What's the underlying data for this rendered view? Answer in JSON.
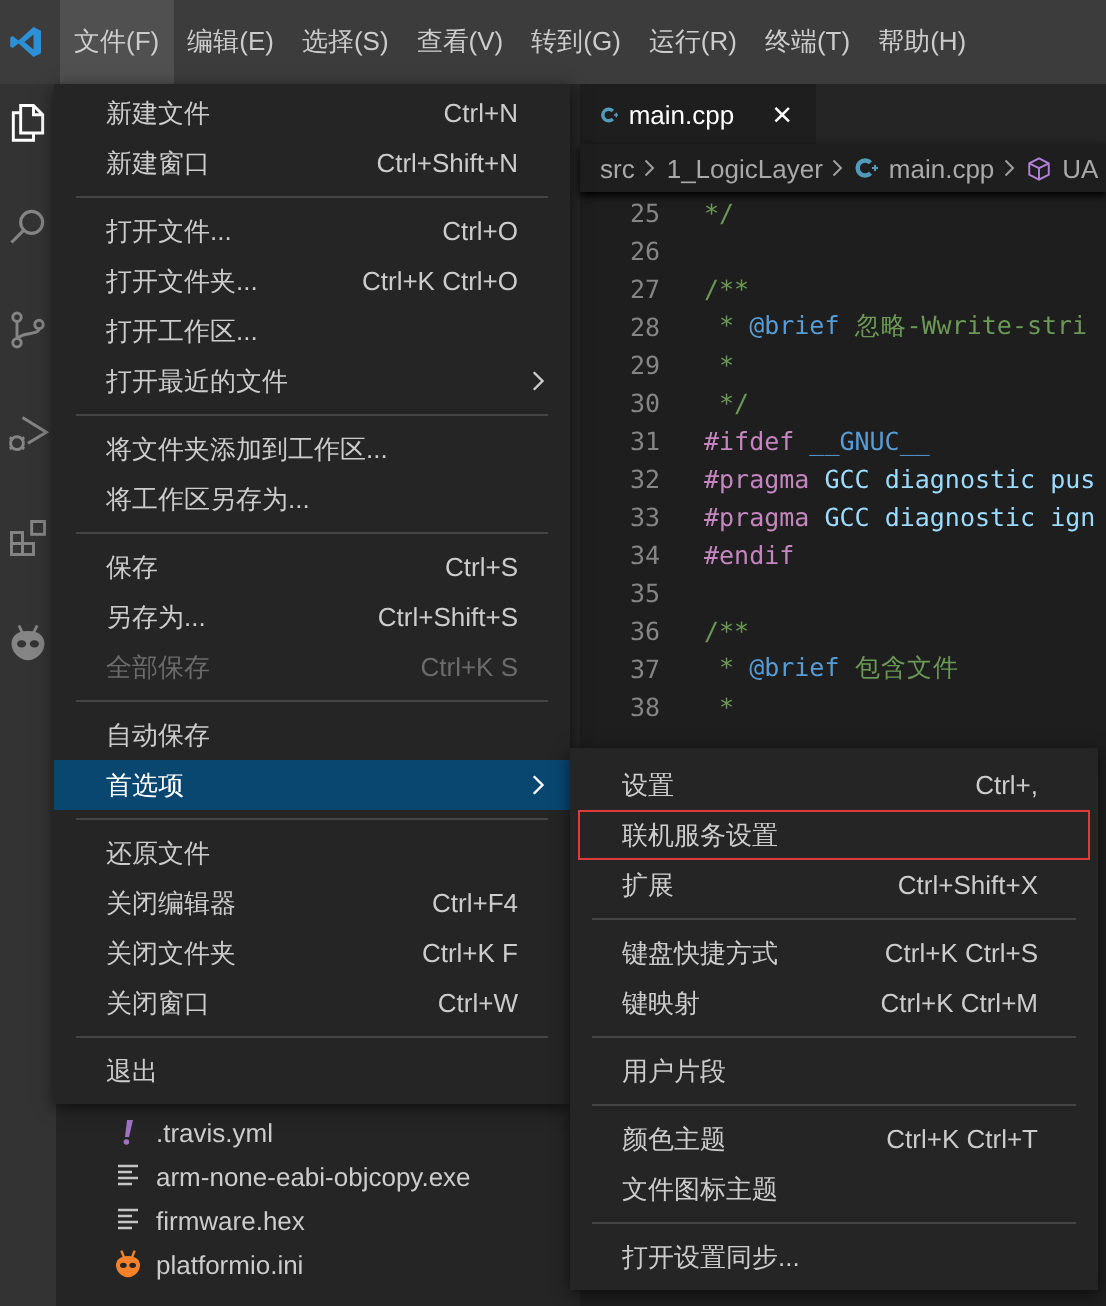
{
  "menubar": [
    {
      "label": "文件(F)",
      "selected": true
    },
    {
      "label": "编辑(E)",
      "selected": false
    },
    {
      "label": "选择(S)",
      "selected": false
    },
    {
      "label": "查看(V)",
      "selected": false
    },
    {
      "label": "转到(G)",
      "selected": false
    },
    {
      "label": "运行(R)",
      "selected": false
    },
    {
      "label": "终端(T)",
      "selected": false
    },
    {
      "label": "帮助(H)",
      "selected": false
    }
  ],
  "activity_bar": [
    {
      "kind": "files",
      "selected": true
    },
    {
      "kind": "search",
      "selected": false
    },
    {
      "kind": "source-control",
      "selected": false
    },
    {
      "kind": "debug",
      "selected": false
    },
    {
      "kind": "extensions",
      "selected": false
    },
    {
      "kind": "platformio",
      "selected": false
    }
  ],
  "explorer": [
    {
      "name": ".travis.yml",
      "kind": "yaml"
    },
    {
      "name": "arm-none-eabi-objcopy.exe",
      "kind": "text"
    },
    {
      "name": "firmware.hex",
      "kind": "text"
    },
    {
      "name": "platformio.ini",
      "kind": "platformio"
    }
  ],
  "editor": {
    "tab": {
      "title": "main.cpp",
      "close": "×"
    },
    "breadcrumb": [
      {
        "text": "src",
        "kind": "folder"
      },
      {
        "text": "1_LogicLayer",
        "kind": "folder"
      },
      {
        "text": "main.cpp",
        "kind": "cpp"
      },
      {
        "text": "UA",
        "kind": "symbol"
      }
    ],
    "lines": [
      {
        "number": "25",
        "tokens": [
          {
            "text": "*/",
            "kind": "comment"
          }
        ]
      },
      {
        "number": "26"
      },
      {
        "number": "27",
        "tokens": [
          {
            "text": "/**",
            "kind": "comment"
          }
        ]
      },
      {
        "number": "28",
        "tokens": [
          {
            "text": " * ",
            "kind": "comment"
          },
          {
            "text": "@brief",
            "kind": "tag"
          },
          {
            "text": " 忽略-Wwrite-stri",
            "kind": "comment"
          }
        ]
      },
      {
        "number": "29",
        "tokens": [
          {
            "text": " *",
            "kind": "comment"
          }
        ]
      },
      {
        "number": "30",
        "tokens": [
          {
            "text": " */",
            "kind": "comment"
          }
        ]
      },
      {
        "number": "31",
        "tokens": [
          {
            "text": "#ifdef",
            "kind": "directive"
          },
          {
            "text": " __GNUC__",
            "kind": "macro"
          }
        ]
      },
      {
        "number": "32",
        "tokens": [
          {
            "text": "#pragma",
            "kind": "directive"
          },
          {
            "text": " GCC diagnostic pus",
            "kind": "plain"
          }
        ]
      },
      {
        "number": "33",
        "tokens": [
          {
            "text": "#pragma",
            "kind": "directive"
          },
          {
            "text": " GCC diagnostic ign",
            "kind": "plain"
          }
        ]
      },
      {
        "number": "34",
        "tokens": [
          {
            "text": "#endif",
            "kind": "directive"
          }
        ]
      },
      {
        "number": "35"
      },
      {
        "number": "36",
        "tokens": [
          {
            "text": "/**",
            "kind": "comment"
          }
        ]
      },
      {
        "number": "37",
        "tokens": [
          {
            "text": " * ",
            "kind": "comment"
          },
          {
            "text": "@brief",
            "kind": "tag"
          },
          {
            "text": " 包含文件",
            "kind": "comment"
          }
        ]
      },
      {
        "number": "38",
        "tokens": [
          {
            "text": " *",
            "kind": "comment"
          }
        ]
      }
    ]
  },
  "file_menu": [
    {
      "kind": "item",
      "label": "新建文件",
      "shortcut": "Ctrl+N",
      "disabled": false,
      "selected": false,
      "submenu": false
    },
    {
      "kind": "item",
      "label": "新建窗口",
      "shortcut": "Ctrl+Shift+N",
      "disabled": false,
      "selected": false,
      "submenu": false
    },
    {
      "kind": "separator"
    },
    {
      "kind": "item",
      "label": "打开文件...",
      "shortcut": "Ctrl+O",
      "disabled": false,
      "selected": false,
      "submenu": false
    },
    {
      "kind": "item",
      "label": "打开文件夹...",
      "shortcut": "Ctrl+K Ctrl+O",
      "disabled": false,
      "selected": false,
      "submenu": false
    },
    {
      "kind": "item",
      "label": "打开工作区...",
      "disabled": false,
      "selected": false,
      "submenu": false
    },
    {
      "kind": "item",
      "label": "打开最近的文件",
      "disabled": false,
      "selected": false,
      "submenu": true
    },
    {
      "kind": "separator"
    },
    {
      "kind": "item",
      "label": "将文件夹添加到工作区...",
      "disabled": false,
      "selected": false,
      "submenu": false
    },
    {
      "kind": "item",
      "label": "将工作区另存为...",
      "disabled": false,
      "selected": false,
      "submenu": false
    },
    {
      "kind": "separator"
    },
    {
      "kind": "item",
      "label": "保存",
      "shortcut": "Ctrl+S",
      "disabled": false,
      "selected": false,
      "submenu": false
    },
    {
      "kind": "item",
      "label": "另存为...",
      "shortcut": "Ctrl+Shift+S",
      "disabled": false,
      "selected": false,
      "submenu": false
    },
    {
      "kind": "item",
      "label": "全部保存",
      "shortcut": "Ctrl+K S",
      "disabled": true,
      "selected": false,
      "submenu": false
    },
    {
      "kind": "separator"
    },
    {
      "kind": "item",
      "label": "自动保存",
      "disabled": false,
      "selected": false,
      "submenu": false
    },
    {
      "kind": "item",
      "label": "首选项",
      "disabled": false,
      "selected": true,
      "submenu": true
    },
    {
      "kind": "separator"
    },
    {
      "kind": "item",
      "label": "还原文件",
      "disabled": false,
      "selected": false,
      "submenu": false
    },
    {
      "kind": "item",
      "label": "关闭编辑器",
      "shortcut": "Ctrl+F4",
      "disabled": false,
      "selected": false,
      "submenu": false
    },
    {
      "kind": "item",
      "label": "关闭文件夹",
      "shortcut": "Ctrl+K F",
      "disabled": false,
      "selected": false,
      "submenu": false
    },
    {
      "kind": "item",
      "label": "关闭窗口",
      "shortcut": "Ctrl+W",
      "disabled": false,
      "selected": false,
      "submenu": false
    },
    {
      "kind": "separator"
    },
    {
      "kind": "item",
      "label": "退出",
      "disabled": false,
      "selected": false,
      "submenu": false
    }
  ],
  "preferences_menu": [
    {
      "kind": "item",
      "label": "设置",
      "shortcut": "Ctrl+,",
      "highlighted": false
    },
    {
      "kind": "item",
      "label": "联机服务设置",
      "highlighted": true
    },
    {
      "kind": "item",
      "label": "扩展",
      "shortcut": "Ctrl+Shift+X",
      "highlighted": false
    },
    {
      "kind": "separator"
    },
    {
      "kind": "item",
      "label": "键盘快捷方式",
      "shortcut": "Ctrl+K Ctrl+S",
      "highlighted": false
    },
    {
      "kind": "item",
      "label": "键映射",
      "shortcut": "Ctrl+K Ctrl+M",
      "highlighted": false
    },
    {
      "kind": "separator"
    },
    {
      "kind": "item",
      "label": "用户片段",
      "highlighted": false
    },
    {
      "kind": "separator"
    },
    {
      "kind": "item",
      "label": "颜色主题",
      "shortcut": "Ctrl+K Ctrl+T",
      "highlighted": false
    },
    {
      "kind": "item",
      "label": "文件图标主题",
      "highlighted": false
    },
    {
      "kind": "separator"
    },
    {
      "kind": "item",
      "label": "打开设置同步...",
      "highlighted": false
    }
  ]
}
